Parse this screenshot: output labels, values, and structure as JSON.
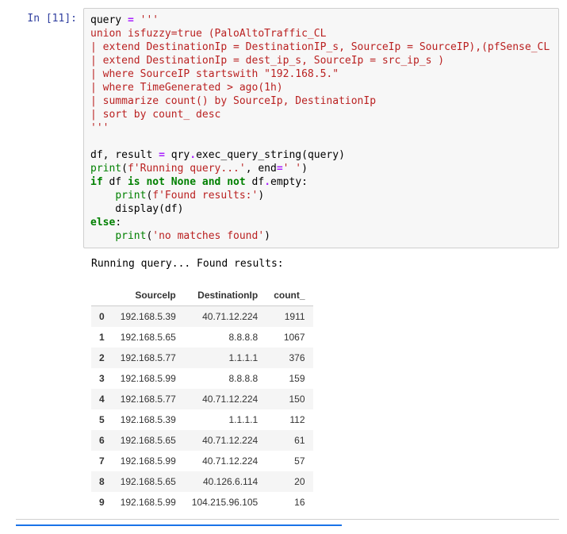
{
  "cell": {
    "prompt": "In [11]:",
    "code_lines": [
      [
        {
          "t": "query ",
          "c": "name"
        },
        {
          "t": "=",
          "c": "op"
        },
        {
          "t": " ",
          "c": "name"
        },
        {
          "t": "'''",
          "c": "str"
        }
      ],
      [
        {
          "t": "union isfuzzy=true (PaloAltoTraffic_CL",
          "c": "str"
        }
      ],
      [
        {
          "t": "| extend DestinationIp = DestinationIP_s, SourceIp = SourceIP),(pfSense_CL",
          "c": "str"
        }
      ],
      [
        {
          "t": "| extend DestinationIp = dest_ip_s, SourceIp = src_ip_s )",
          "c": "str"
        }
      ],
      [
        {
          "t": "| where SourceIP startswith \"192.168.5.\"",
          "c": "str"
        }
      ],
      [
        {
          "t": "| where TimeGenerated > ago(1h)",
          "c": "str"
        }
      ],
      [
        {
          "t": "| summarize count() by SourceIp, DestinationIp",
          "c": "str"
        }
      ],
      [
        {
          "t": "| sort by count_ desc",
          "c": "str"
        }
      ],
      [
        {
          "t": "'''",
          "c": "str"
        }
      ],
      [
        {
          "t": "",
          "c": "name"
        }
      ],
      [
        {
          "t": "df, result ",
          "c": "name"
        },
        {
          "t": "=",
          "c": "op"
        },
        {
          "t": " qry",
          "c": "name"
        },
        {
          "t": ".",
          "c": "op"
        },
        {
          "t": "exec_query_string(query)",
          "c": "name"
        }
      ],
      [
        {
          "t": "print",
          "c": "builtin"
        },
        {
          "t": "(",
          "c": "name"
        },
        {
          "t": "f'Running query...'",
          "c": "str"
        },
        {
          "t": ", end",
          "c": "name"
        },
        {
          "t": "=",
          "c": "op"
        },
        {
          "t": "' '",
          "c": "str"
        },
        {
          "t": ")",
          "c": "name"
        }
      ],
      [
        {
          "t": "if",
          "c": "kw"
        },
        {
          "t": " df ",
          "c": "name"
        },
        {
          "t": "is",
          "c": "kw"
        },
        {
          "t": " ",
          "c": "name"
        },
        {
          "t": "not",
          "c": "kw"
        },
        {
          "t": " ",
          "c": "name"
        },
        {
          "t": "None",
          "c": "kw"
        },
        {
          "t": " ",
          "c": "name"
        },
        {
          "t": "and",
          "c": "kw"
        },
        {
          "t": " ",
          "c": "name"
        },
        {
          "t": "not",
          "c": "kw"
        },
        {
          "t": " df",
          "c": "name"
        },
        {
          "t": ".",
          "c": "op"
        },
        {
          "t": "empty:",
          "c": "name"
        }
      ],
      [
        {
          "t": "    ",
          "c": "name"
        },
        {
          "t": "print",
          "c": "builtin"
        },
        {
          "t": "(",
          "c": "name"
        },
        {
          "t": "f'Found results:'",
          "c": "str"
        },
        {
          "t": ")",
          "c": "name"
        }
      ],
      [
        {
          "t": "    display(df)",
          "c": "name"
        }
      ],
      [
        {
          "t": "else",
          "c": "kw"
        },
        {
          "t": ":",
          "c": "name"
        }
      ],
      [
        {
          "t": "    ",
          "c": "name"
        },
        {
          "t": "print",
          "c": "builtin"
        },
        {
          "t": "(",
          "c": "name"
        },
        {
          "t": "'no matches found'",
          "c": "str"
        },
        {
          "t": ")",
          "c": "name"
        }
      ]
    ]
  },
  "output_text": "Running query... Found results:",
  "chart_data": {
    "type": "table",
    "columns": [
      "SourceIp",
      "DestinationIp",
      "count_"
    ],
    "index": [
      "0",
      "1",
      "2",
      "3",
      "4",
      "5",
      "6",
      "7",
      "8",
      "9"
    ],
    "rows": [
      [
        "192.168.5.39",
        "40.71.12.224",
        "1911"
      ],
      [
        "192.168.5.65",
        "8.8.8.8",
        "1067"
      ],
      [
        "192.168.5.77",
        "1.1.1.1",
        "376"
      ],
      [
        "192.168.5.99",
        "8.8.8.8",
        "159"
      ],
      [
        "192.168.5.77",
        "40.71.12.224",
        "150"
      ],
      [
        "192.168.5.39",
        "1.1.1.1",
        "112"
      ],
      [
        "192.168.5.65",
        "40.71.12.224",
        "61"
      ],
      [
        "192.168.5.99",
        "40.71.12.224",
        "57"
      ],
      [
        "192.168.5.65",
        "40.126.6.114",
        "20"
      ],
      [
        "192.168.5.99",
        "104.215.96.105",
        "16"
      ]
    ]
  }
}
